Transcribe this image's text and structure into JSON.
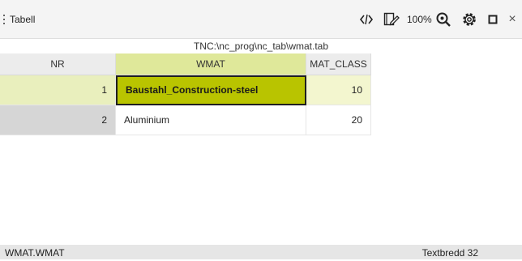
{
  "toolbar": {
    "menu_icon": "vertical-dots-icon",
    "title": "Tabell",
    "zoom": "100%",
    "icons": [
      "code-brackets-icon",
      "form-edit-icon",
      "zoom-icon",
      "gear-icon",
      "maximize-icon",
      "close-icon"
    ],
    "close_glyph": "×"
  },
  "path": "TNC:\\nc_prog\\nc_tab\\wmat.tab",
  "table": {
    "columns": [
      "NR",
      "WMAT",
      "MAT_CLASS"
    ],
    "rows": [
      {
        "nr": "1",
        "wmat": "Baustahl_Construction-steel",
        "mat_class": "10"
      },
      {
        "nr": "2",
        "wmat": "Aluminium",
        "mat_class": "20"
      }
    ]
  },
  "status": {
    "left": "WMAT.WMAT",
    "right": "Textbredd 32"
  },
  "colors": {
    "selected_cell": "#b9c400",
    "selected_header": "#dfe89a",
    "selected_row": "#f3f6cf"
  }
}
